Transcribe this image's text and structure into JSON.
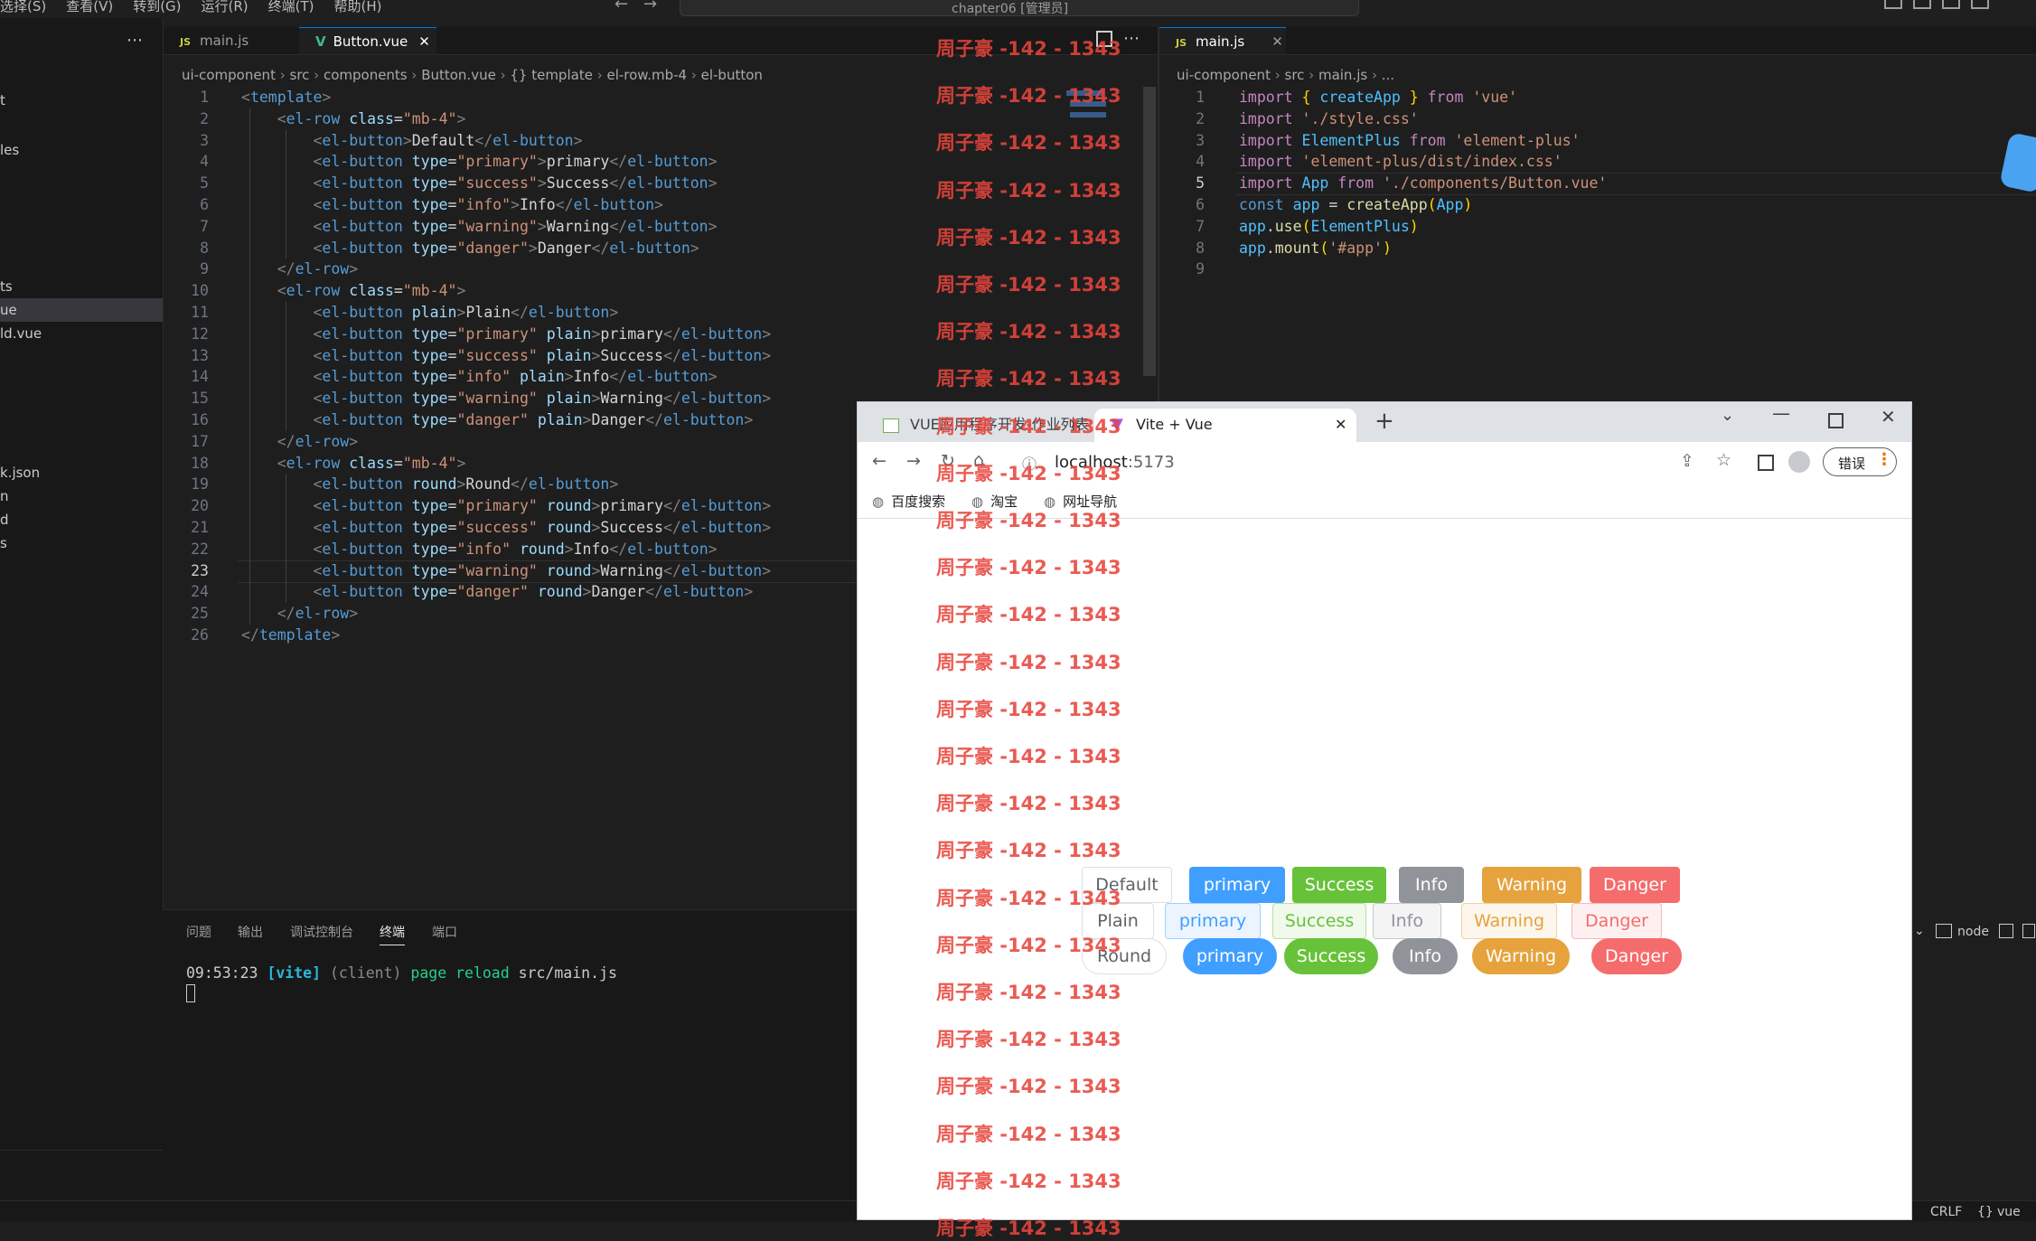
{
  "window": {
    "menu": [
      "选择(S)",
      "查看(V)",
      "转到(G)",
      "运行(R)",
      "终端(T)",
      "帮助(H)"
    ],
    "search_text": "chapter06 [管理员]"
  },
  "sidebar": {
    "items": [
      {
        "label": "t"
      },
      {
        "label": "les"
      },
      {
        "label": "ts"
      },
      {
        "label": "ue"
      },
      {
        "label": "ld.vue"
      },
      {
        "label": "k.json"
      },
      {
        "label": "n"
      },
      {
        "label": "d"
      },
      {
        "label": "s"
      }
    ]
  },
  "left_editor": {
    "tabs": [
      {
        "label": "main.js",
        "icon": "JS"
      },
      {
        "label": "Button.vue",
        "icon": "V"
      }
    ],
    "breadcrumb": [
      "ui-component",
      "src",
      "components",
      "Button.vue",
      "{} template",
      "el-row.mb-4",
      "el-button"
    ],
    "lines": [
      [
        [
          "t",
          "<"
        ],
        [
          "tg",
          "template"
        ],
        [
          "t",
          ">"
        ]
      ],
      [
        [
          "t",
          "    <"
        ],
        [
          "tg",
          "el-row"
        ],
        [
          "tx",
          " "
        ],
        [
          "at",
          "class"
        ],
        [
          "tx",
          "="
        ],
        [
          "st",
          "\"mb-4\""
        ],
        [
          "t",
          ">"
        ]
      ],
      [
        [
          "t",
          "        <"
        ],
        [
          "tg",
          "el-button"
        ],
        [
          "t",
          ">"
        ],
        [
          "tx",
          "Default"
        ],
        [
          "t",
          "</"
        ],
        [
          "tg",
          "el-button"
        ],
        [
          "t",
          ">"
        ]
      ],
      [
        [
          "t",
          "        <"
        ],
        [
          "tg",
          "el-button"
        ],
        [
          "tx",
          " "
        ],
        [
          "at",
          "type"
        ],
        [
          "tx",
          "="
        ],
        [
          "st",
          "\"primary\""
        ],
        [
          "t",
          ">"
        ],
        [
          "tx",
          "primary"
        ],
        [
          "t",
          "</"
        ],
        [
          "tg",
          "el-button"
        ],
        [
          "t",
          ">"
        ]
      ],
      [
        [
          "t",
          "        <"
        ],
        [
          "tg",
          "el-button"
        ],
        [
          "tx",
          " "
        ],
        [
          "at",
          "type"
        ],
        [
          "tx",
          "="
        ],
        [
          "st",
          "\"success\""
        ],
        [
          "t",
          ">"
        ],
        [
          "tx",
          "Success"
        ],
        [
          "t",
          "</"
        ],
        [
          "tg",
          "el-button"
        ],
        [
          "t",
          ">"
        ]
      ],
      [
        [
          "t",
          "        <"
        ],
        [
          "tg",
          "el-button"
        ],
        [
          "tx",
          " "
        ],
        [
          "at",
          "type"
        ],
        [
          "tx",
          "="
        ],
        [
          "st",
          "\"info\""
        ],
        [
          "t",
          ">"
        ],
        [
          "tx",
          "Info"
        ],
        [
          "t",
          "</"
        ],
        [
          "tg",
          "el-button"
        ],
        [
          "t",
          ">"
        ]
      ],
      [
        [
          "t",
          "        <"
        ],
        [
          "tg",
          "el-button"
        ],
        [
          "tx",
          " "
        ],
        [
          "at",
          "type"
        ],
        [
          "tx",
          "="
        ],
        [
          "st",
          "\"warning\""
        ],
        [
          "t",
          ">"
        ],
        [
          "tx",
          "Warning"
        ],
        [
          "t",
          "</"
        ],
        [
          "tg",
          "el-button"
        ],
        [
          "t",
          ">"
        ]
      ],
      [
        [
          "t",
          "        <"
        ],
        [
          "tg",
          "el-button"
        ],
        [
          "tx",
          " "
        ],
        [
          "at",
          "type"
        ],
        [
          "tx",
          "="
        ],
        [
          "st",
          "\"danger\""
        ],
        [
          "t",
          ">"
        ],
        [
          "tx",
          "Danger"
        ],
        [
          "t",
          "</"
        ],
        [
          "tg",
          "el-button"
        ],
        [
          "t",
          ">"
        ]
      ],
      [
        [
          "t",
          "    </"
        ],
        [
          "tg",
          "el-row"
        ],
        [
          "t",
          ">"
        ]
      ],
      [
        [
          "t",
          "    <"
        ],
        [
          "tg",
          "el-row"
        ],
        [
          "tx",
          " "
        ],
        [
          "at",
          "class"
        ],
        [
          "tx",
          "="
        ],
        [
          "st",
          "\"mb-4\""
        ],
        [
          "t",
          ">"
        ]
      ],
      [
        [
          "t",
          "        <"
        ],
        [
          "tg",
          "el-button"
        ],
        [
          "tx",
          " "
        ],
        [
          "at",
          "plain"
        ],
        [
          "t",
          ">"
        ],
        [
          "tx",
          "Plain"
        ],
        [
          "t",
          "</"
        ],
        [
          "tg",
          "el-button"
        ],
        [
          "t",
          ">"
        ]
      ],
      [
        [
          "t",
          "        <"
        ],
        [
          "tg",
          "el-button"
        ],
        [
          "tx",
          " "
        ],
        [
          "at",
          "type"
        ],
        [
          "tx",
          "="
        ],
        [
          "st",
          "\"primary\""
        ],
        [
          "tx",
          " "
        ],
        [
          "at",
          "plain"
        ],
        [
          "t",
          ">"
        ],
        [
          "tx",
          "primary"
        ],
        [
          "t",
          "</"
        ],
        [
          "tg",
          "el-button"
        ],
        [
          "t",
          ">"
        ]
      ],
      [
        [
          "t",
          "        <"
        ],
        [
          "tg",
          "el-button"
        ],
        [
          "tx",
          " "
        ],
        [
          "at",
          "type"
        ],
        [
          "tx",
          "="
        ],
        [
          "st",
          "\"success\""
        ],
        [
          "tx",
          " "
        ],
        [
          "at",
          "plain"
        ],
        [
          "t",
          ">"
        ],
        [
          "tx",
          "Success"
        ],
        [
          "t",
          "</"
        ],
        [
          "tg",
          "el-button"
        ],
        [
          "t",
          ">"
        ]
      ],
      [
        [
          "t",
          "        <"
        ],
        [
          "tg",
          "el-button"
        ],
        [
          "tx",
          " "
        ],
        [
          "at",
          "type"
        ],
        [
          "tx",
          "="
        ],
        [
          "st",
          "\"info\""
        ],
        [
          "tx",
          " "
        ],
        [
          "at",
          "plain"
        ],
        [
          "t",
          ">"
        ],
        [
          "tx",
          "Info"
        ],
        [
          "t",
          "</"
        ],
        [
          "tg",
          "el-button"
        ],
        [
          "t",
          ">"
        ]
      ],
      [
        [
          "t",
          "        <"
        ],
        [
          "tg",
          "el-button"
        ],
        [
          "tx",
          " "
        ],
        [
          "at",
          "type"
        ],
        [
          "tx",
          "="
        ],
        [
          "st",
          "\"warning\""
        ],
        [
          "tx",
          " "
        ],
        [
          "at",
          "plain"
        ],
        [
          "t",
          ">"
        ],
        [
          "tx",
          "Warning"
        ],
        [
          "t",
          "</"
        ],
        [
          "tg",
          "el-button"
        ],
        [
          "t",
          ">"
        ]
      ],
      [
        [
          "t",
          "        <"
        ],
        [
          "tg",
          "el-button"
        ],
        [
          "tx",
          " "
        ],
        [
          "at",
          "type"
        ],
        [
          "tx",
          "="
        ],
        [
          "st",
          "\"danger\""
        ],
        [
          "tx",
          " "
        ],
        [
          "at",
          "plain"
        ],
        [
          "t",
          ">"
        ],
        [
          "tx",
          "Danger"
        ],
        [
          "t",
          "</"
        ],
        [
          "tg",
          "el-button"
        ],
        [
          "t",
          ">"
        ]
      ],
      [
        [
          "t",
          "    </"
        ],
        [
          "tg",
          "el-row"
        ],
        [
          "t",
          ">"
        ]
      ],
      [
        [
          "t",
          "    <"
        ],
        [
          "tg",
          "el-row"
        ],
        [
          "tx",
          " "
        ],
        [
          "at",
          "class"
        ],
        [
          "tx",
          "="
        ],
        [
          "st",
          "\"mb-4\""
        ],
        [
          "t",
          ">"
        ]
      ],
      [
        [
          "t",
          "        <"
        ],
        [
          "tg",
          "el-button"
        ],
        [
          "tx",
          " "
        ],
        [
          "at",
          "round"
        ],
        [
          "t",
          ">"
        ],
        [
          "tx",
          "Round"
        ],
        [
          "t",
          "</"
        ],
        [
          "tg",
          "el-button"
        ],
        [
          "t",
          ">"
        ]
      ],
      [
        [
          "t",
          "        <"
        ],
        [
          "tg",
          "el-button"
        ],
        [
          "tx",
          " "
        ],
        [
          "at",
          "type"
        ],
        [
          "tx",
          "="
        ],
        [
          "st",
          "\"primary\""
        ],
        [
          "tx",
          " "
        ],
        [
          "at",
          "round"
        ],
        [
          "t",
          ">"
        ],
        [
          "tx",
          "primary"
        ],
        [
          "t",
          "</"
        ],
        [
          "tg",
          "el-button"
        ],
        [
          "t",
          ">"
        ]
      ],
      [
        [
          "t",
          "        <"
        ],
        [
          "tg",
          "el-button"
        ],
        [
          "tx",
          " "
        ],
        [
          "at",
          "type"
        ],
        [
          "tx",
          "="
        ],
        [
          "st",
          "\"success\""
        ],
        [
          "tx",
          " "
        ],
        [
          "at",
          "round"
        ],
        [
          "t",
          ">"
        ],
        [
          "tx",
          "Success"
        ],
        [
          "t",
          "</"
        ],
        [
          "tg",
          "el-button"
        ],
        [
          "t",
          ">"
        ]
      ],
      [
        [
          "t",
          "        <"
        ],
        [
          "tg",
          "el-button"
        ],
        [
          "tx",
          " "
        ],
        [
          "at",
          "type"
        ],
        [
          "tx",
          "="
        ],
        [
          "st",
          "\"info\""
        ],
        [
          "tx",
          " "
        ],
        [
          "at",
          "round"
        ],
        [
          "t",
          ">"
        ],
        [
          "tx",
          "Info"
        ],
        [
          "t",
          "</"
        ],
        [
          "tg",
          "el-button"
        ],
        [
          "t",
          ">"
        ]
      ],
      [
        [
          "t",
          "        <"
        ],
        [
          "tg",
          "el-button"
        ],
        [
          "tx",
          " "
        ],
        [
          "at",
          "type"
        ],
        [
          "tx",
          "="
        ],
        [
          "st",
          "\"warning\""
        ],
        [
          "tx",
          " "
        ],
        [
          "at",
          "round"
        ],
        [
          "t",
          ">"
        ],
        [
          "tx",
          "Warning"
        ],
        [
          "t",
          "</"
        ],
        [
          "tg",
          "el-button"
        ],
        [
          "t",
          ">"
        ]
      ],
      [
        [
          "t",
          "        <"
        ],
        [
          "tg",
          "el-button"
        ],
        [
          "tx",
          " "
        ],
        [
          "at",
          "type"
        ],
        [
          "tx",
          "="
        ],
        [
          "st",
          "\"danger\""
        ],
        [
          "tx",
          " "
        ],
        [
          "at",
          "round"
        ],
        [
          "t",
          ">"
        ],
        [
          "tx",
          "Danger"
        ],
        [
          "t",
          "</"
        ],
        [
          "tg",
          "el-button"
        ],
        [
          "t",
          ">"
        ]
      ],
      [
        [
          "t",
          "    </"
        ],
        [
          "tg",
          "el-row"
        ],
        [
          "t",
          ">"
        ]
      ],
      [
        [
          "t",
          "</"
        ],
        [
          "tg",
          "template"
        ],
        [
          "t",
          ">"
        ]
      ]
    ],
    "current_line": 23
  },
  "right_editor": {
    "tabs": [
      {
        "label": "main.js",
        "icon": "JS"
      }
    ],
    "breadcrumb": [
      "ui-component",
      "src",
      "main.js",
      "..."
    ],
    "lines": [
      [
        [
          "kw",
          "import"
        ],
        [
          "tx",
          " "
        ],
        [
          "pu",
          "{"
        ],
        [
          "tx",
          " "
        ],
        [
          "vr",
          "createApp"
        ],
        [
          "tx",
          " "
        ],
        [
          "pu",
          "}"
        ],
        [
          "tx",
          " "
        ],
        [
          "kw",
          "from"
        ],
        [
          "tx",
          " "
        ],
        [
          "st",
          "'vue'"
        ]
      ],
      [
        [
          "kw",
          "import"
        ],
        [
          "tx",
          " "
        ],
        [
          "st",
          "'./style.css'"
        ]
      ],
      [
        [
          "kw",
          "import"
        ],
        [
          "tx",
          " "
        ],
        [
          "vr",
          "ElementPlus"
        ],
        [
          "tx",
          " "
        ],
        [
          "kw",
          "from"
        ],
        [
          "tx",
          " "
        ],
        [
          "st",
          "'element-plus'"
        ]
      ],
      [
        [
          "kw",
          "import"
        ],
        [
          "tx",
          " "
        ],
        [
          "st",
          "'element-plus/dist/index.css'"
        ]
      ],
      [
        [
          "kw",
          "import"
        ],
        [
          "tx",
          " "
        ],
        [
          "vr",
          "App"
        ],
        [
          "tx",
          " "
        ],
        [
          "kw",
          "from"
        ],
        [
          "tx",
          " "
        ],
        [
          "st",
          "'./components/Button.vue'"
        ]
      ],
      [
        [
          "tg",
          "const"
        ],
        [
          "tx",
          " "
        ],
        [
          "vr",
          "app"
        ],
        [
          "tx",
          " = "
        ],
        [
          "fn",
          "createApp"
        ],
        [
          "pu",
          "("
        ],
        [
          "vr",
          "App"
        ],
        [
          "pu",
          ")"
        ]
      ],
      [
        [
          "vr",
          "app"
        ],
        [
          "tx",
          "."
        ],
        [
          "fn",
          "use"
        ],
        [
          "pu",
          "("
        ],
        [
          "vr",
          "ElementPlus"
        ],
        [
          "pu",
          ")"
        ]
      ],
      [
        [
          "vr",
          "app"
        ],
        [
          "tx",
          "."
        ],
        [
          "fn",
          "mount"
        ],
        [
          "pu",
          "("
        ],
        [
          "st",
          "'#app'"
        ],
        [
          "pu",
          ")"
        ]
      ],
      []
    ],
    "current_line": 5
  },
  "panel": {
    "tabs": [
      "问题",
      "输出",
      "调试控制台",
      "终端",
      "端口"
    ],
    "active_tab": "终端",
    "terminal": {
      "time": "09:53:23",
      "vite": "[vite]",
      "client": "(client)",
      "msg": "page reload",
      "file": "src/main.js"
    },
    "right_label": "node"
  },
  "statusbar": {
    "eol": "CRLF",
    "lang": "vue"
  },
  "watermark": {
    "text": "周子豪 -142 - 1343"
  },
  "browser": {
    "tabs": [
      {
        "label": "VUE应用程序开发-作业列表"
      },
      {
        "label": "Vite + Vue"
      }
    ],
    "url_host": "localhost",
    "url_port": ":5173",
    "error_label": "错误",
    "bookmarks": [
      "百度搜索",
      "淘宝",
      "网址导航"
    ],
    "rows": [
      {
        "variant": "default",
        "buttons": [
          "Default",
          "primary",
          "Success",
          "Info",
          "Warning",
          "Danger"
        ]
      },
      {
        "variant": "plain",
        "buttons": [
          "Plain",
          "primary",
          "Success",
          "Info",
          "Warning",
          "Danger"
        ]
      },
      {
        "variant": "round",
        "buttons": [
          "Round",
          "primary",
          "Success",
          "Info",
          "Warning",
          "Danger"
        ]
      }
    ],
    "colors": {
      "primary": "#409eff",
      "success": "#67c23a",
      "info": "#909399",
      "warning": "#e6a23c",
      "danger": "#f56c6c"
    }
  }
}
